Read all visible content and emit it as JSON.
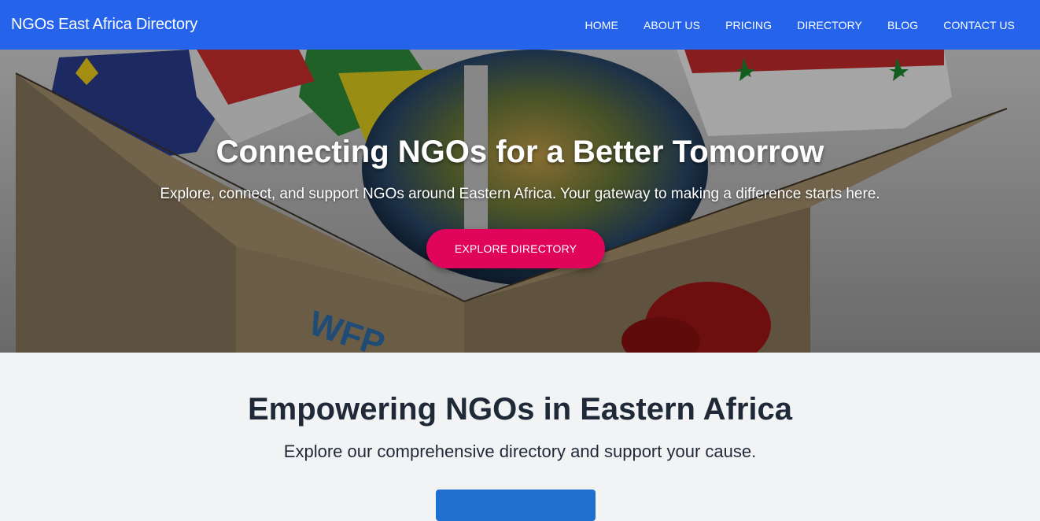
{
  "navbar": {
    "brand": "NGOs East Africa Directory",
    "links": [
      "HOME",
      "ABOUT US",
      "PRICING",
      "DIRECTORY",
      "BLOG",
      "CONTACT US"
    ],
    "background": "#2563eb"
  },
  "hero": {
    "title": "Connecting NGOs for a Better Tomorrow",
    "subtitle": "Explore, connect, and support NGOs around Eastern Africa. Your gateway to making a difference starts here.",
    "button_label": "EXPLORE DIRECTORY",
    "button_color": "#e0045a",
    "image_box_text": "WFP"
  },
  "section": {
    "title": "Empowering NGOs in Eastern Africa",
    "subtitle": "Explore our comprehensive directory and support your cause.",
    "button_label": "",
    "button_color": "#1f6fd1"
  }
}
